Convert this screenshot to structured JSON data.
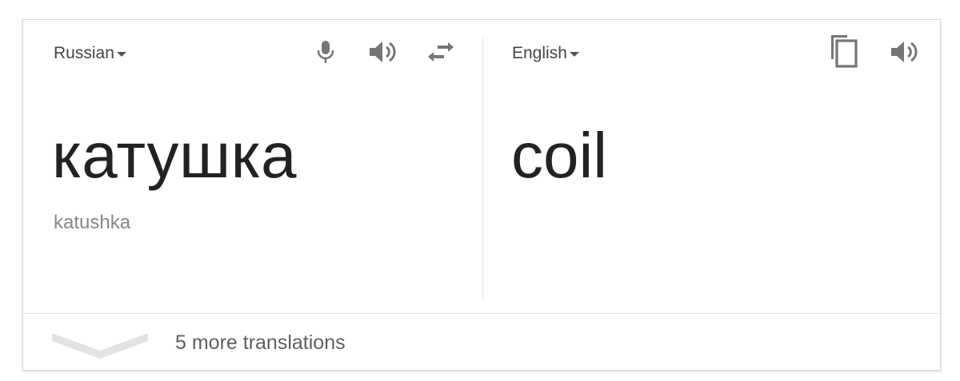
{
  "source": {
    "language": "Russian",
    "text": "катушка",
    "transliteration": "katushka",
    "icons": {
      "microphone": "microphone-icon",
      "speaker": "speaker-icon",
      "swap": "swap-languages-icon"
    }
  },
  "target": {
    "language": "English",
    "text": "coil",
    "icons": {
      "copy": "copy-icon",
      "speaker": "speaker-icon"
    }
  },
  "footer": {
    "more_translations_label": "5 more translations",
    "expand_icon": "chevron-down-icon"
  },
  "colors": {
    "icon": "#757575",
    "text_primary": "#222222",
    "text_secondary": "#878787",
    "chevron": "#e0e0e0"
  }
}
